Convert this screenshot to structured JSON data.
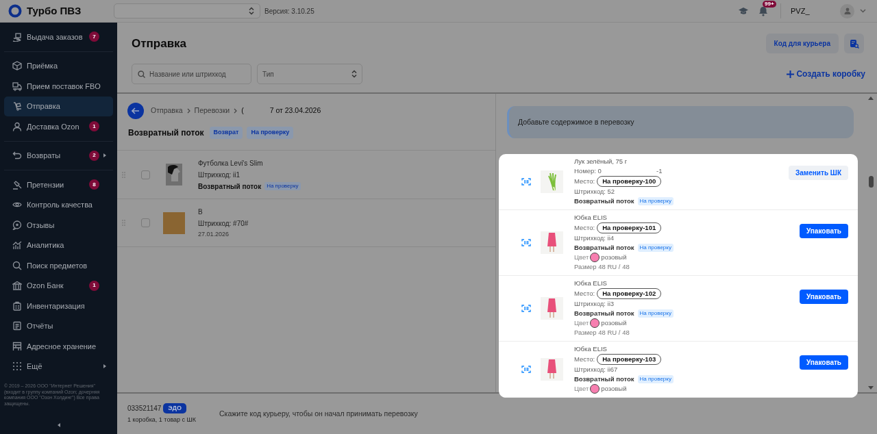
{
  "topbar": {
    "app_name": "Турбо ПВЗ",
    "version": "Версия: 3.10.25",
    "notifications_badge": "99+",
    "user": "PVZ_"
  },
  "sidebar": {
    "groups": [
      {
        "items": [
          {
            "label": "Выдача заказов",
            "badge": "7",
            "selected": false,
            "submenu": false
          }
        ]
      },
      {
        "items": [
          {
            "label": "Приёмка",
            "selected": false,
            "submenu": false
          },
          {
            "label": "Прием поставок FBO",
            "selected": false,
            "submenu": false
          },
          {
            "label": "Отправка",
            "selected": true,
            "submenu": false
          },
          {
            "label": "Доставка Ozon",
            "badge": "1",
            "selected": false,
            "submenu": false
          }
        ]
      },
      {
        "items": [
          {
            "label": "Возвраты",
            "badge": "2",
            "selected": false,
            "submenu": true
          }
        ]
      },
      {
        "items": [
          {
            "label": "Претензии",
            "badge": "8",
            "selected": false,
            "submenu": false
          },
          {
            "label": "Контроль качества",
            "selected": false,
            "submenu": false
          },
          {
            "label": "Отзывы",
            "selected": false,
            "submenu": false
          },
          {
            "label": "Аналитика",
            "selected": false,
            "submenu": false
          },
          {
            "label": "Поиск предметов",
            "selected": false,
            "submenu": false
          },
          {
            "label": "Ozon Банк",
            "badge": "1",
            "selected": false,
            "submenu": false
          },
          {
            "label": "Инвентаризация",
            "selected": false,
            "submenu": false
          },
          {
            "label": "Отчёты",
            "selected": false,
            "submenu": false
          },
          {
            "label": "Адресное хранение",
            "selected": false,
            "submenu": false
          },
          {
            "label": "Ещё",
            "selected": false,
            "submenu": true
          }
        ]
      }
    ],
    "copyright": "© 2019 – 2026 ООО \"Интернет Решения\" (входит в группу компаний Ozon; дочерняя компания ООО \"Озон Холдинг\") Все права защищены."
  },
  "page": {
    "title": "Отправка",
    "courier_code_button": "Код для курьера",
    "search": {
      "placeholder": "Название или штрихкод"
    },
    "type_select": {
      "placeholder": "Тип"
    },
    "create_box": "Создать коробку"
  },
  "breadcrumbs": [
    {
      "text": "Отправка"
    },
    {
      "text": "Перевозки"
    },
    {
      "text": "(",
      "tail": "7 от 23.04.2026"
    }
  ],
  "section": {
    "title": "Возвратный поток",
    "tags": [
      "Возврат",
      "На проверку"
    ]
  },
  "items": [
    {
      "title": "Футболка Levi's Slim",
      "barcode": "Штрихкод: ii1",
      "checked": false,
      "kind": "photo",
      "extra": {
        "kind": "flow",
        "text": "Возвратный поток",
        "tag": "На проверку"
      }
    },
    {
      "title": "B",
      "barcode": "Штрихкод: #70#",
      "checked": false,
      "kind": "swatch",
      "extra": {
        "kind": "date",
        "text": "27.01.2026"
      }
    }
  ],
  "info": "Добавьте содержимое в перевозку",
  "box_items": [
    {
      "name": "Лук зелёный, 75 г",
      "number": [
        "Номер: 0",
        "-1"
      ],
      "place_label": "Место:",
      "place": "На проверку-100",
      "barcode": "Штрихкод: 52",
      "flow": "Возвратный поток",
      "flow_tag": "На проверку",
      "kind": "produce",
      "button": {
        "label": "Заменить ШК",
        "kind": "secondary"
      }
    },
    {
      "name": "Юбка ELIS",
      "place_label": "Место:",
      "place": "На проверку-101",
      "barcode": "Штрихкод: ii4",
      "flow": "Возвратный поток",
      "flow_tag": "На проверку",
      "color_label": "Цвет",
      "color_name": "розовый",
      "color": "#f77fb0",
      "size": "Размер 48 RU / 48",
      "kind": "clothing",
      "button": {
        "label": "Упаковать",
        "kind": "primary"
      }
    },
    {
      "name": "Юбка ELIS",
      "place_label": "Место:",
      "place": "На проверку-102",
      "barcode": "Штрихкод: ii3",
      "flow": "Возвратный поток",
      "flow_tag": "На проверку",
      "color_label": "Цвет",
      "color_name": "розовый",
      "color": "#f77fb0",
      "size": "Размер 48 RU / 48",
      "kind": "clothing",
      "button": {
        "label": "Упаковать",
        "kind": "primary"
      }
    },
    {
      "name": "Юбка ELIS",
      "place_label": "Место:",
      "place": "На проверку-103",
      "barcode": "Штрихкод: ii67",
      "flow": "Возвратный поток",
      "flow_tag": "На проверку",
      "color_label": "Цвет",
      "color_name": "розовый",
      "color": "#f77fb0",
      "kind": "clothing",
      "button": {
        "label": "Упаковать",
        "kind": "primary"
      }
    }
  ],
  "footer": {
    "number": "033521147",
    "badge": "ЭДО",
    "summary": "1 коробка, 1 товар с ШК",
    "hint": "Скажите код курьеру, чтобы он начал принимать перевозку"
  }
}
